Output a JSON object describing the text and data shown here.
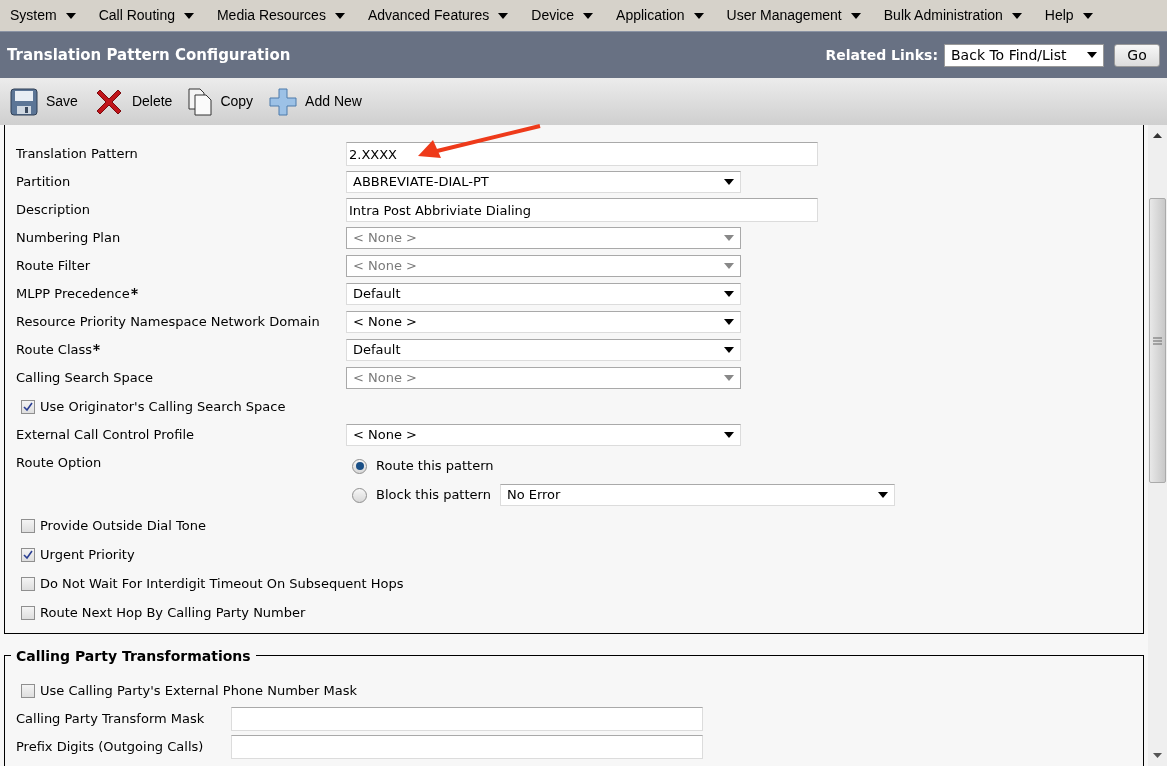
{
  "menu": [
    {
      "label": "System"
    },
    {
      "label": "Call Routing"
    },
    {
      "label": "Media Resources"
    },
    {
      "label": "Advanced Features"
    },
    {
      "label": "Device"
    },
    {
      "label": "Application"
    },
    {
      "label": "User Management"
    },
    {
      "label": "Bulk Administration"
    },
    {
      "label": "Help"
    }
  ],
  "page_title": "Translation Pattern Configuration",
  "related_links": {
    "label": "Related Links:",
    "value": "Back To Find/List",
    "button": "Go"
  },
  "toolbar": [
    {
      "kind": "save",
      "label": "Save"
    },
    {
      "kind": "delete",
      "label": "Delete"
    },
    {
      "kind": "copy",
      "label": "Copy"
    },
    {
      "kind": "add",
      "label": "Add New"
    }
  ],
  "pattern_definition": {
    "rows": [
      {
        "kind": "text",
        "label": "Translation Pattern",
        "value": "2.XXXX",
        "required": false
      },
      {
        "kind": "select",
        "label": "Partition",
        "value": "ABBREVIATE-DIAL-PT",
        "disabled": false,
        "required": false
      },
      {
        "kind": "text",
        "label": "Description",
        "value": "Intra Post Abbriviate Dialing",
        "required": false
      },
      {
        "kind": "select",
        "label": "Numbering Plan",
        "value": "< None >",
        "disabled": true,
        "required": false
      },
      {
        "kind": "select",
        "label": "Route Filter",
        "value": "< None >",
        "disabled": true,
        "required": false
      },
      {
        "kind": "select",
        "label": "MLPP Precedence",
        "value": "Default",
        "disabled": false,
        "required": true
      },
      {
        "kind": "select",
        "label": "Resource Priority Namespace Network Domain",
        "value": "< None >",
        "disabled": false,
        "required": false
      },
      {
        "kind": "select",
        "label": "Route Class",
        "value": "Default",
        "disabled": false,
        "required": true
      },
      {
        "kind": "select",
        "label": "Calling Search Space",
        "value": "< None >",
        "disabled": true,
        "required": false
      },
      {
        "kind": "checkbox",
        "label": "Use Originator's Calling Search Space",
        "checked": true
      },
      {
        "kind": "select",
        "label": "External Call Control Profile",
        "value": "< None >",
        "disabled": false,
        "required": false
      },
      {
        "kind": "radio_group",
        "label": "Route Option",
        "options": [
          {
            "label": "Route this pattern",
            "selected": true
          },
          {
            "label": "Block this pattern",
            "selected": false,
            "select_value": "No Error"
          }
        ]
      },
      {
        "kind": "checkbox",
        "label": "Provide Outside Dial Tone",
        "checked": false
      },
      {
        "kind": "checkbox",
        "label": "Urgent Priority",
        "checked": true
      },
      {
        "kind": "checkbox",
        "label": "Do Not Wait For Interdigit Timeout On Subsequent Hops",
        "checked": false
      },
      {
        "kind": "checkbox",
        "label": "Route Next Hop By Calling Party Number",
        "checked": false
      }
    ]
  },
  "calling_party_transformations": {
    "title": "Calling Party Transformations",
    "rows": [
      {
        "kind": "checkbox",
        "label": "Use Calling Party's External Phone Number Mask",
        "checked": false
      },
      {
        "kind": "text",
        "label": "Calling Party Transform Mask",
        "value": "",
        "required": false
      },
      {
        "kind": "text",
        "label": "Prefix Digits (Outgoing Calls)",
        "value": "",
        "required": false
      }
    ]
  }
}
